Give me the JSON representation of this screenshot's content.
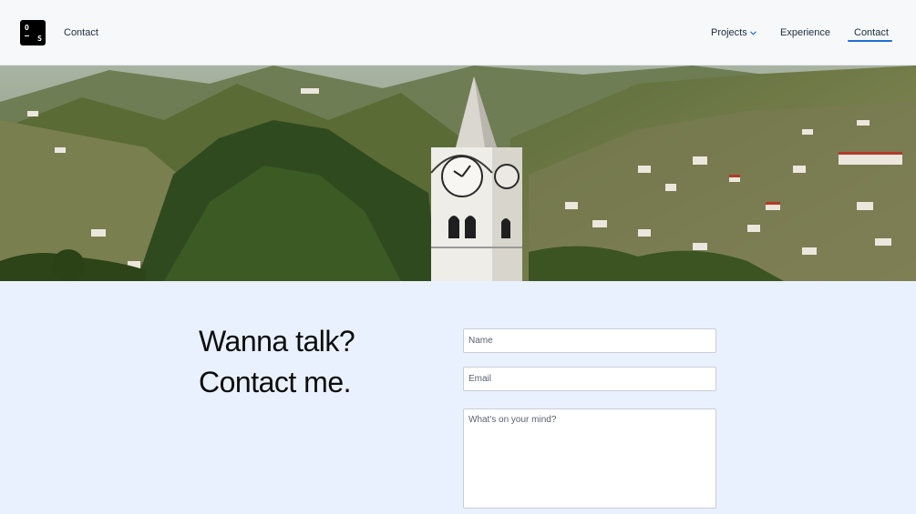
{
  "header": {
    "logo_top": "O",
    "logo_bottom": "S",
    "page_title": "Contact",
    "nav": {
      "projects": "Projects",
      "experience": "Experience",
      "contact": "Contact"
    }
  },
  "hero": {
    "image": "mountain-village-church-tower-photo"
  },
  "main": {
    "heading_line1": "Wanna talk?",
    "heading_line2": "Contact me.",
    "form": {
      "name_placeholder": "Name",
      "email_placeholder": "Email",
      "message_placeholder": "What's on your mind?"
    }
  },
  "colors": {
    "accent": "#1f6fd6",
    "background": "#e8f1fd",
    "header": "#f6f8fa"
  }
}
